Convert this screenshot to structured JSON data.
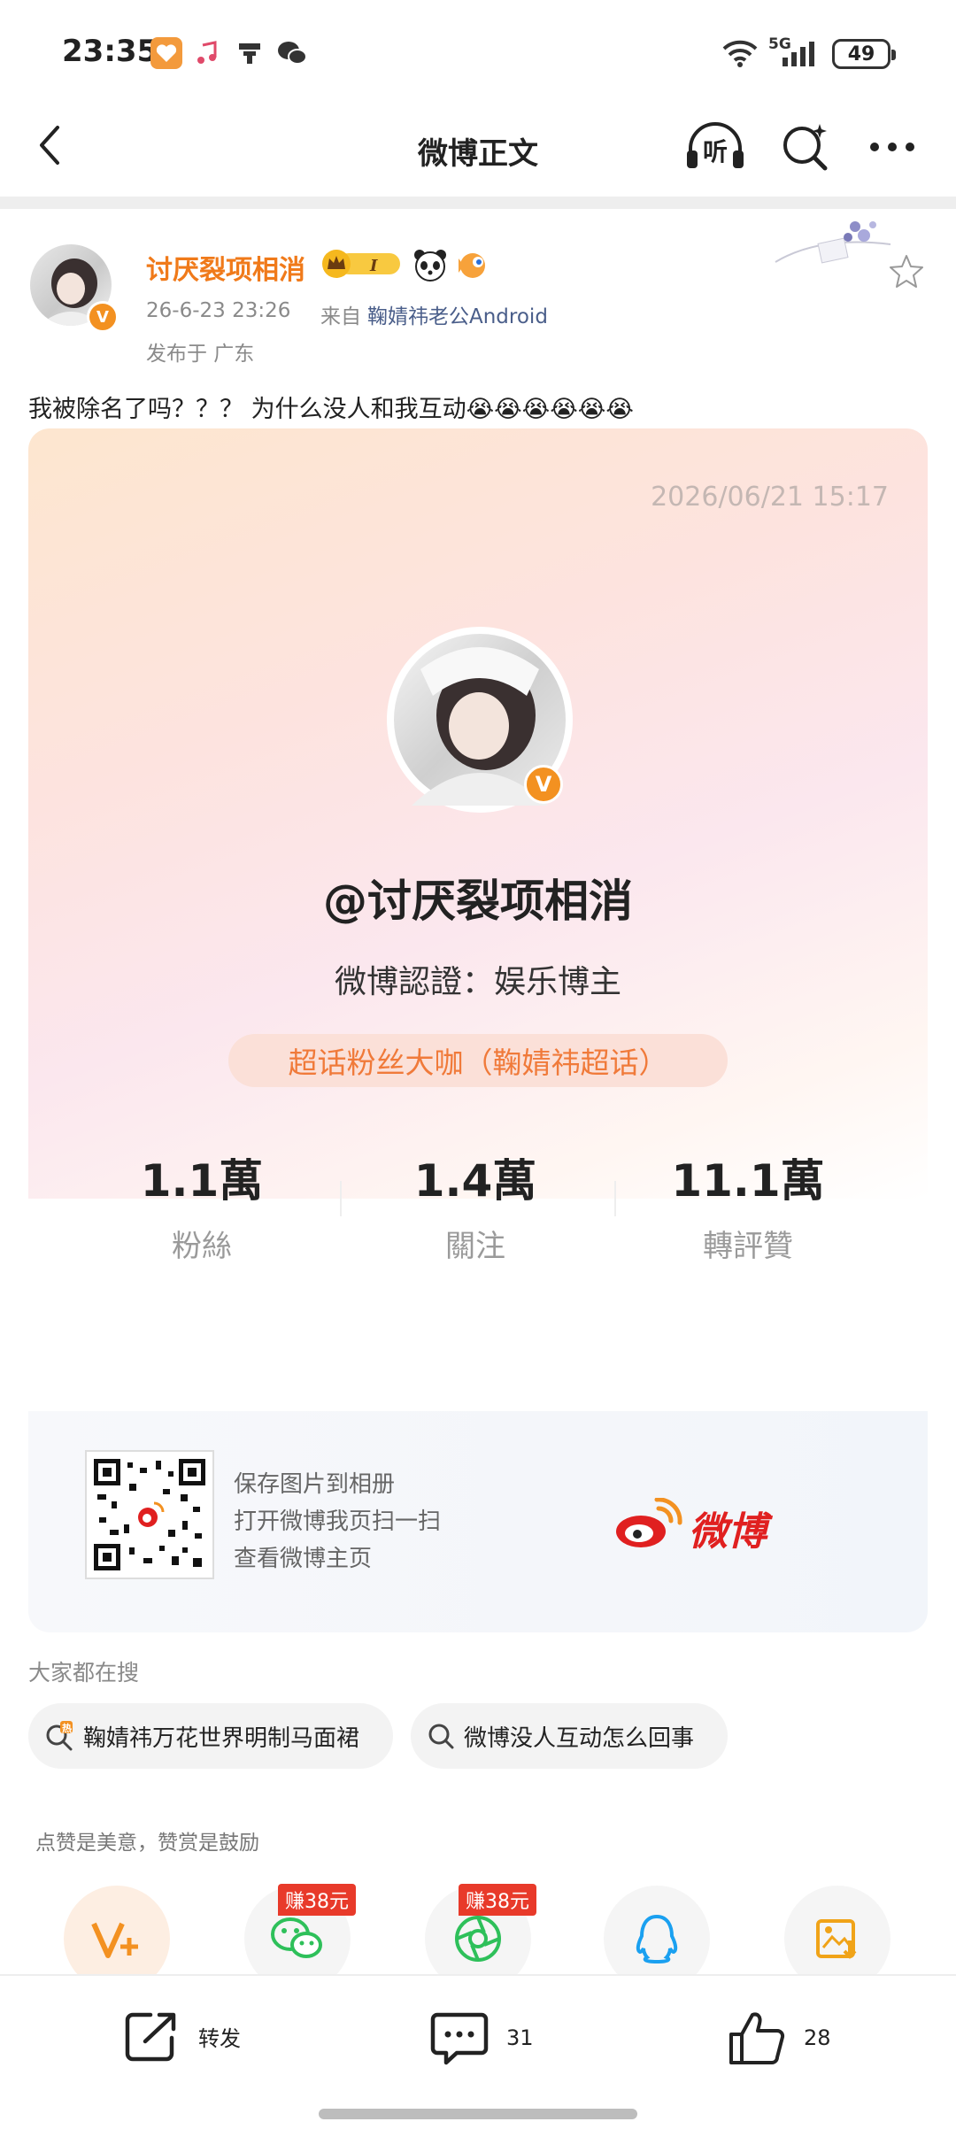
{
  "status_bar": {
    "time": "23:35",
    "network": "5G",
    "battery": "49"
  },
  "nav": {
    "title": "微博正文",
    "listen_label": "听"
  },
  "post": {
    "username": "讨厌裂项相消",
    "date": "26-6-23 23:26",
    "from_label": "来自",
    "source": "鞠婧祎老公Android",
    "location": "发布于 广东",
    "text": "我被除名了吗？？？ 为什么没人和我互动😭😭😭😭😭😭"
  },
  "card": {
    "date": "2026/06/21 15:17",
    "handle": "@讨厌裂项相消",
    "certification": "微博認證：娱乐博主",
    "super_topic": "超话粉丝大咖（鞠婧祎超话）",
    "stats": [
      {
        "value": "1.1萬",
        "label": "粉絲"
      },
      {
        "value": "1.4萬",
        "label": "關注"
      },
      {
        "value": "11.1萬",
        "label": "轉評贊"
      }
    ],
    "qr_lines": [
      "保存图片到相册",
      "打开微博我页扫一扫",
      "查看微博主页"
    ],
    "logo_text": "微博"
  },
  "searches": {
    "heading": "大家都在搜",
    "items": [
      "鞠婧祎万花世界明制马面裙",
      "微博没人互动怎么回事"
    ]
  },
  "reward": {
    "tip": "点赞是美意，赞赏是鼓励",
    "earn_tag": "赚38元"
  },
  "bottom_bar": {
    "repost_label": "转发",
    "comment_count": "31",
    "like_count": "28"
  },
  "colors": {
    "accent_orange": "#f07a1a",
    "link_blue": "#4a5e8a",
    "weibo_red": "#e02020"
  }
}
